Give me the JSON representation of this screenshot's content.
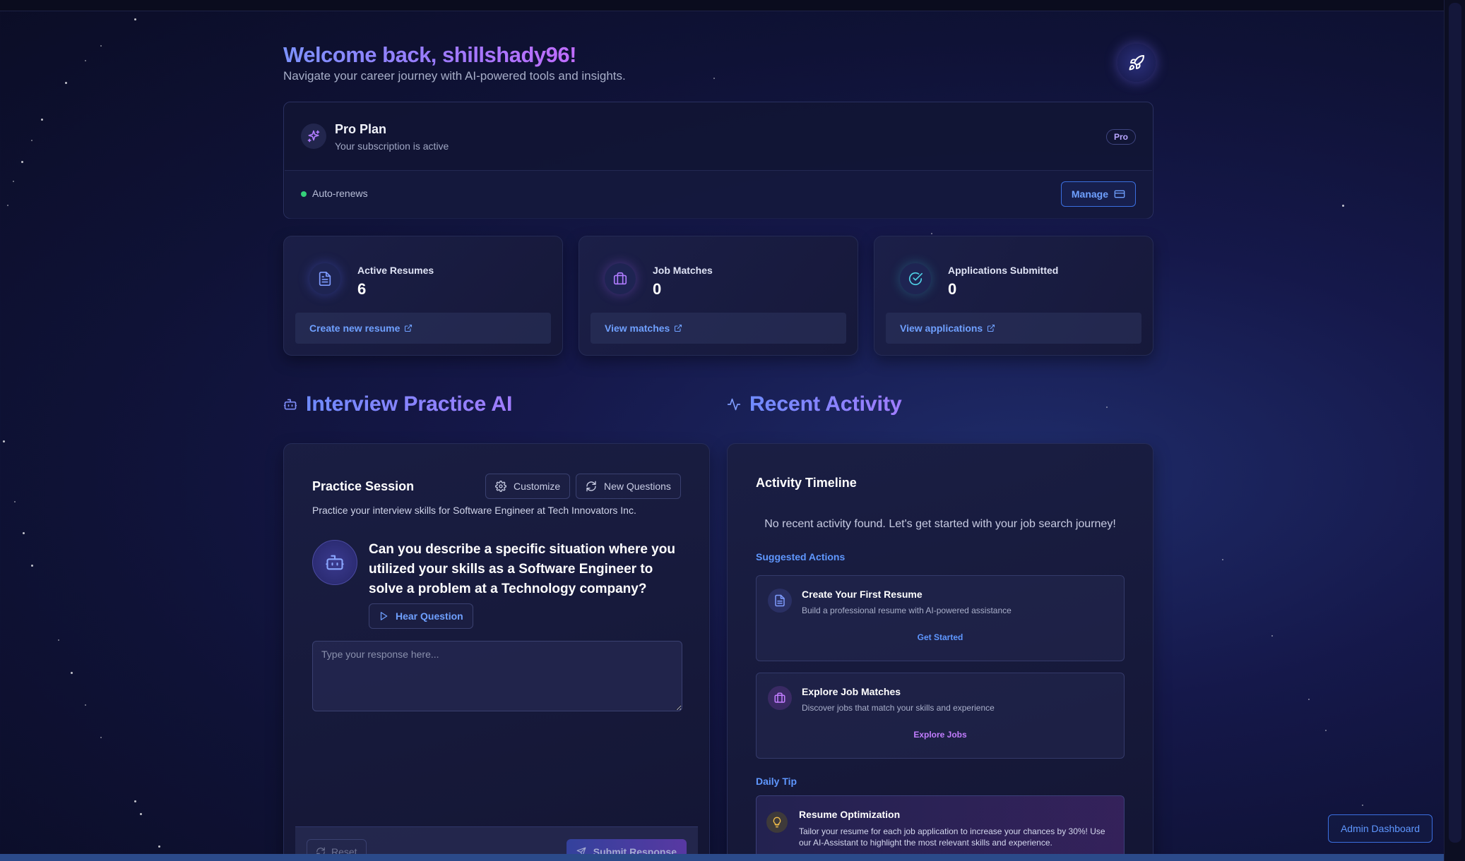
{
  "header": {
    "welcome": "Welcome back, shillshady96!",
    "subtitle": "Navigate your career journey with AI-powered tools and insights."
  },
  "subscription": {
    "plan_name": "Pro Plan",
    "status": "Your subscription is active",
    "badge": "Pro",
    "renewal": "Auto-renews",
    "manage_label": "Manage"
  },
  "stats": [
    {
      "label": "Active Resumes",
      "value": "6",
      "link": "Create new resume",
      "icon": "document-icon"
    },
    {
      "label": "Job Matches",
      "value": "0",
      "link": "View matches",
      "icon": "briefcase-icon"
    },
    {
      "label": "Applications Submitted",
      "value": "0",
      "link": "View applications",
      "icon": "check-circle-icon"
    }
  ],
  "interview": {
    "section_title": "Interview Practice AI",
    "panel_title": "Practice Session",
    "customize_label": "Customize",
    "new_questions_label": "New Questions",
    "description": "Practice your interview skills for Software Engineer at Tech Innovators Inc.",
    "question": "Can you describe a specific situation where you utilized your skills as a Software Engineer to solve a problem at a Technology company?",
    "hear_label": "Hear Question",
    "response_placeholder": "Type your response here...",
    "reset_label": "Reset",
    "submit_label": "Submit Response"
  },
  "activity": {
    "section_title": "Recent Activity",
    "panel_title": "Activity Timeline",
    "empty_message": "No recent activity found. Let's get started with your job search journey!",
    "suggested_heading": "Suggested Actions",
    "suggestions": [
      {
        "title": "Create Your First Resume",
        "description": "Build a professional resume with AI-powered assistance",
        "action": "Get Started",
        "color": "#5f97ff"
      },
      {
        "title": "Explore Job Matches",
        "description": "Discover jobs that match your skills and experience",
        "action": "Explore Jobs",
        "color": "#c27dff"
      }
    ],
    "tip_heading": "Daily Tip",
    "tip": {
      "title": "Resume Optimization",
      "text": "Tailor your resume for each job application to increase your chances by 30%! Use our AI-Assistant to highlight the most relevant skills and experience."
    }
  },
  "admin_label": "Admin Dashboard",
  "colors": {
    "accent": "#5f97ff",
    "purple": "#b07cff",
    "success": "#34d17a"
  }
}
